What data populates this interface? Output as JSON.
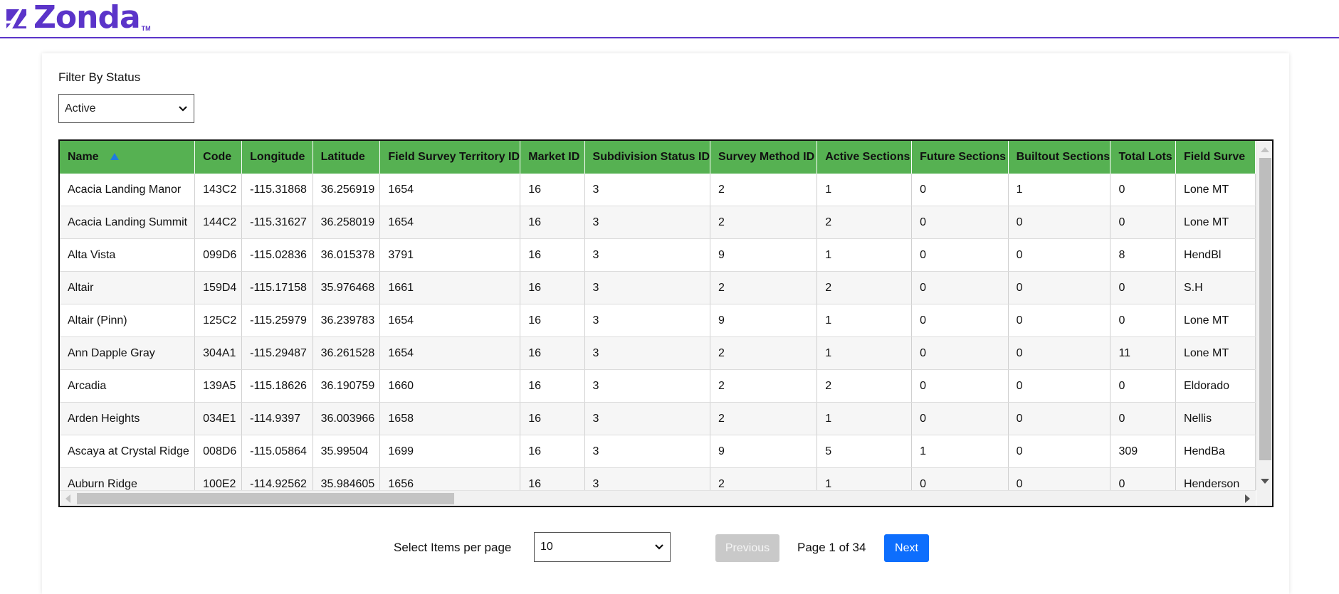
{
  "brand": {
    "name": "Zonda",
    "tm": "TM",
    "color": "#5b34c9"
  },
  "filter": {
    "label": "Filter By Status",
    "selected": "Active"
  },
  "table": {
    "header_color": "#56b152",
    "sort_column": "Name",
    "sort_direction": "ascending",
    "columns": [
      "Name",
      "Code",
      "Longitude",
      "Latitude",
      "Field Survey Territory ID",
      "Market ID",
      "Subdivision Status ID",
      "Survey Method ID",
      "Active Sections",
      "Future Sections",
      "Builtout Sections",
      "Total Lots",
      "Field Surve"
    ],
    "rows": [
      [
        "Acacia Landing Manor",
        "143C2",
        "-115.31868",
        "36.256919",
        "1654",
        "16",
        "3",
        "2",
        "1",
        "0",
        "1",
        "0",
        "Lone MT"
      ],
      [
        "Acacia Landing Summit",
        "144C2",
        "-115.31627",
        "36.258019",
        "1654",
        "16",
        "3",
        "2",
        "2",
        "0",
        "0",
        "0",
        "Lone MT"
      ],
      [
        "Alta Vista",
        "099D6",
        "-115.02836",
        "36.015378",
        "3791",
        "16",
        "3",
        "9",
        "1",
        "0",
        "0",
        "8",
        "HendBl"
      ],
      [
        "Altair",
        "159D4",
        "-115.17158",
        "35.976468",
        "1661",
        "16",
        "3",
        "2",
        "2",
        "0",
        "0",
        "0",
        "S.H"
      ],
      [
        "Altair (Pinn)",
        "125C2",
        "-115.25979",
        "36.239783",
        "1654",
        "16",
        "3",
        "9",
        "1",
        "0",
        "0",
        "0",
        "Lone MT"
      ],
      [
        "Ann Dapple Gray",
        "304A1",
        "-115.29487",
        "36.261528",
        "1654",
        "16",
        "3",
        "2",
        "1",
        "0",
        "0",
        "11",
        "Lone MT"
      ],
      [
        "Arcadia",
        "139A5",
        "-115.18626",
        "36.190759",
        "1660",
        "16",
        "3",
        "2",
        "2",
        "0",
        "0",
        "0",
        "Eldorado"
      ],
      [
        "Arden Heights",
        "034E1",
        "-114.9397",
        "36.003966",
        "1658",
        "16",
        "3",
        "2",
        "1",
        "0",
        "0",
        "0",
        "Nellis"
      ],
      [
        "Ascaya at Crystal Ridge",
        "008D6",
        "-115.05864",
        "35.99504",
        "1699",
        "16",
        "3",
        "9",
        "5",
        "1",
        "0",
        "309",
        "HendBa"
      ],
      [
        "Auburn Ridge",
        "100E2",
        "-114.92562",
        "35.984605",
        "1656",
        "16",
        "3",
        "2",
        "1",
        "0",
        "0",
        "0",
        "Henderson"
      ]
    ]
  },
  "pagination": {
    "items_label": "Select Items per page",
    "items_value": "10",
    "previous_label": "Previous",
    "next_label": "Next",
    "page_info": "Page 1 of 34"
  }
}
